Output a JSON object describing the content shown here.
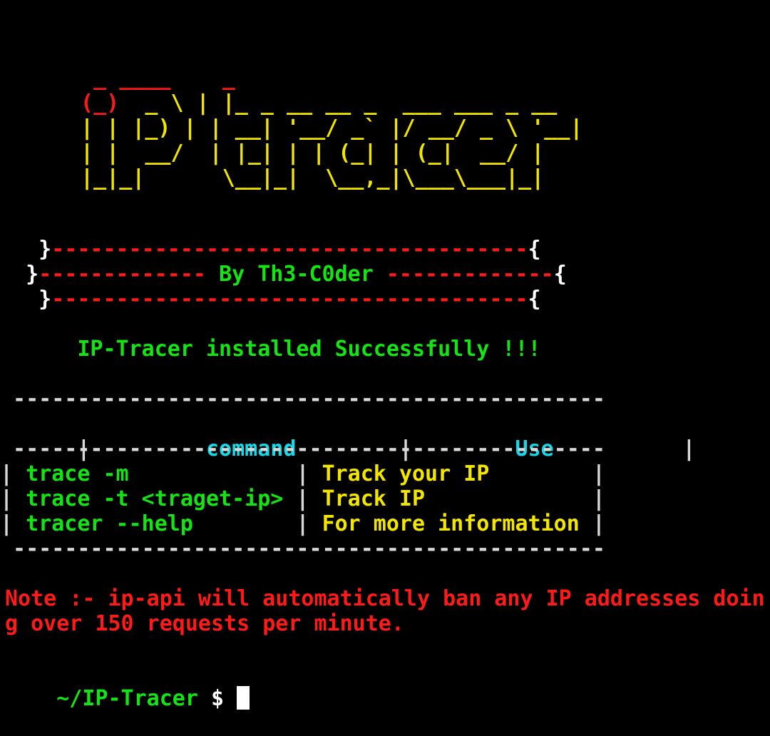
{
  "banner": {
    "logo_lines": [
      [
        {
          "t": "  _ ____    _",
          "c": "red"
        }
      ],
      [
        {
          "t": " (_)",
          "c": "red"
        },
        {
          "t": "  _ \\ | |_ _ __ __ _  ___ ___ _ __",
          "c": "yellow"
        }
      ],
      [
        {
          "t": " | | |_) | | __| '__/ _` |/ __/ _ \\ '__|",
          "c": "yellow"
        }
      ],
      [
        {
          "t": " | |  __/  | |_| | | (_| | (_|  __/ |",
          "c": "yellow"
        }
      ],
      [
        {
          "t": " |_|_|      \\__|_|  \\__,_|\\___\\___|_|",
          "c": "yellow"
        }
      ]
    ],
    "credit_top": [
      {
        "t": "   }",
        "c": "white"
      },
      {
        "t": "-------------------------------------",
        "c": "red"
      },
      {
        "t": "{",
        "c": "white"
      }
    ],
    "credit_mid": [
      {
        "t": "  }",
        "c": "white"
      },
      {
        "t": "------------- ",
        "c": "red"
      },
      {
        "t": "By Th3-C0der",
        "c": "green"
      },
      {
        "t": " -------------",
        "c": "red"
      },
      {
        "t": "{",
        "c": "white"
      }
    ],
    "credit_bot": [
      {
        "t": "   }",
        "c": "white"
      },
      {
        "t": "-------------------------------------",
        "c": "red"
      },
      {
        "t": "{",
        "c": "white"
      }
    ]
  },
  "status_message": "      IP-Tracer installed Successfully !!!",
  "command_table": {
    "rule": " ----------------------------------------------",
    "header": {
      "command": "command",
      "use": "Use"
    },
    "rows": [
      {
        "command": "trace -m",
        "use": "Track your IP"
      },
      {
        "command": "trace -t <traget-ip>",
        "use": "Track IP"
      },
      {
        "command": "tracer --help",
        "use": "For more information"
      }
    ]
  },
  "note": {
    "line1": "Note :- ip-api will automatically ban any IP addresses doin",
    "line2": "g over 150 requests per minute."
  },
  "prompt": {
    "path": "~/IP-Tracer",
    "symbol": "$"
  }
}
